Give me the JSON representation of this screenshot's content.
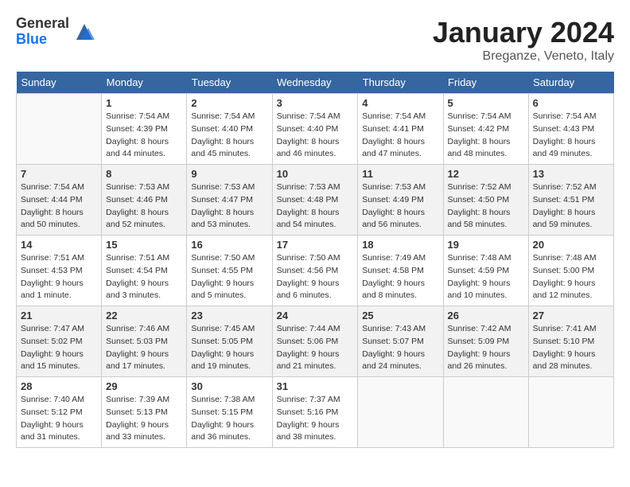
{
  "header": {
    "logo_general": "General",
    "logo_blue": "Blue",
    "month_year": "January 2024",
    "location": "Breganze, Veneto, Italy"
  },
  "columns": [
    "Sunday",
    "Monday",
    "Tuesday",
    "Wednesday",
    "Thursday",
    "Friday",
    "Saturday"
  ],
  "weeks": [
    [
      {
        "day": "",
        "info": ""
      },
      {
        "day": "1",
        "info": "Sunrise: 7:54 AM\nSunset: 4:39 PM\nDaylight: 8 hours\nand 44 minutes."
      },
      {
        "day": "2",
        "info": "Sunrise: 7:54 AM\nSunset: 4:40 PM\nDaylight: 8 hours\nand 45 minutes."
      },
      {
        "day": "3",
        "info": "Sunrise: 7:54 AM\nSunset: 4:40 PM\nDaylight: 8 hours\nand 46 minutes."
      },
      {
        "day": "4",
        "info": "Sunrise: 7:54 AM\nSunset: 4:41 PM\nDaylight: 8 hours\nand 47 minutes."
      },
      {
        "day": "5",
        "info": "Sunrise: 7:54 AM\nSunset: 4:42 PM\nDaylight: 8 hours\nand 48 minutes."
      },
      {
        "day": "6",
        "info": "Sunrise: 7:54 AM\nSunset: 4:43 PM\nDaylight: 8 hours\nand 49 minutes."
      }
    ],
    [
      {
        "day": "7",
        "info": "Sunrise: 7:54 AM\nSunset: 4:44 PM\nDaylight: 8 hours\nand 50 minutes."
      },
      {
        "day": "8",
        "info": "Sunrise: 7:53 AM\nSunset: 4:46 PM\nDaylight: 8 hours\nand 52 minutes."
      },
      {
        "day": "9",
        "info": "Sunrise: 7:53 AM\nSunset: 4:47 PM\nDaylight: 8 hours\nand 53 minutes."
      },
      {
        "day": "10",
        "info": "Sunrise: 7:53 AM\nSunset: 4:48 PM\nDaylight: 8 hours\nand 54 minutes."
      },
      {
        "day": "11",
        "info": "Sunrise: 7:53 AM\nSunset: 4:49 PM\nDaylight: 8 hours\nand 56 minutes."
      },
      {
        "day": "12",
        "info": "Sunrise: 7:52 AM\nSunset: 4:50 PM\nDaylight: 8 hours\nand 58 minutes."
      },
      {
        "day": "13",
        "info": "Sunrise: 7:52 AM\nSunset: 4:51 PM\nDaylight: 8 hours\nand 59 minutes."
      }
    ],
    [
      {
        "day": "14",
        "info": "Sunrise: 7:51 AM\nSunset: 4:53 PM\nDaylight: 9 hours\nand 1 minute."
      },
      {
        "day": "15",
        "info": "Sunrise: 7:51 AM\nSunset: 4:54 PM\nDaylight: 9 hours\nand 3 minutes."
      },
      {
        "day": "16",
        "info": "Sunrise: 7:50 AM\nSunset: 4:55 PM\nDaylight: 9 hours\nand 5 minutes."
      },
      {
        "day": "17",
        "info": "Sunrise: 7:50 AM\nSunset: 4:56 PM\nDaylight: 9 hours\nand 6 minutes."
      },
      {
        "day": "18",
        "info": "Sunrise: 7:49 AM\nSunset: 4:58 PM\nDaylight: 9 hours\nand 8 minutes."
      },
      {
        "day": "19",
        "info": "Sunrise: 7:48 AM\nSunset: 4:59 PM\nDaylight: 9 hours\nand 10 minutes."
      },
      {
        "day": "20",
        "info": "Sunrise: 7:48 AM\nSunset: 5:00 PM\nDaylight: 9 hours\nand 12 minutes."
      }
    ],
    [
      {
        "day": "21",
        "info": "Sunrise: 7:47 AM\nSunset: 5:02 PM\nDaylight: 9 hours\nand 15 minutes."
      },
      {
        "day": "22",
        "info": "Sunrise: 7:46 AM\nSunset: 5:03 PM\nDaylight: 9 hours\nand 17 minutes."
      },
      {
        "day": "23",
        "info": "Sunrise: 7:45 AM\nSunset: 5:05 PM\nDaylight: 9 hours\nand 19 minutes."
      },
      {
        "day": "24",
        "info": "Sunrise: 7:44 AM\nSunset: 5:06 PM\nDaylight: 9 hours\nand 21 minutes."
      },
      {
        "day": "25",
        "info": "Sunrise: 7:43 AM\nSunset: 5:07 PM\nDaylight: 9 hours\nand 24 minutes."
      },
      {
        "day": "26",
        "info": "Sunrise: 7:42 AM\nSunset: 5:09 PM\nDaylight: 9 hours\nand 26 minutes."
      },
      {
        "day": "27",
        "info": "Sunrise: 7:41 AM\nSunset: 5:10 PM\nDaylight: 9 hours\nand 28 minutes."
      }
    ],
    [
      {
        "day": "28",
        "info": "Sunrise: 7:40 AM\nSunset: 5:12 PM\nDaylight: 9 hours\nand 31 minutes."
      },
      {
        "day": "29",
        "info": "Sunrise: 7:39 AM\nSunset: 5:13 PM\nDaylight: 9 hours\nand 33 minutes."
      },
      {
        "day": "30",
        "info": "Sunrise: 7:38 AM\nSunset: 5:15 PM\nDaylight: 9 hours\nand 36 minutes."
      },
      {
        "day": "31",
        "info": "Sunrise: 7:37 AM\nSunset: 5:16 PM\nDaylight: 9 hours\nand 38 minutes."
      },
      {
        "day": "",
        "info": ""
      },
      {
        "day": "",
        "info": ""
      },
      {
        "day": "",
        "info": ""
      }
    ]
  ]
}
